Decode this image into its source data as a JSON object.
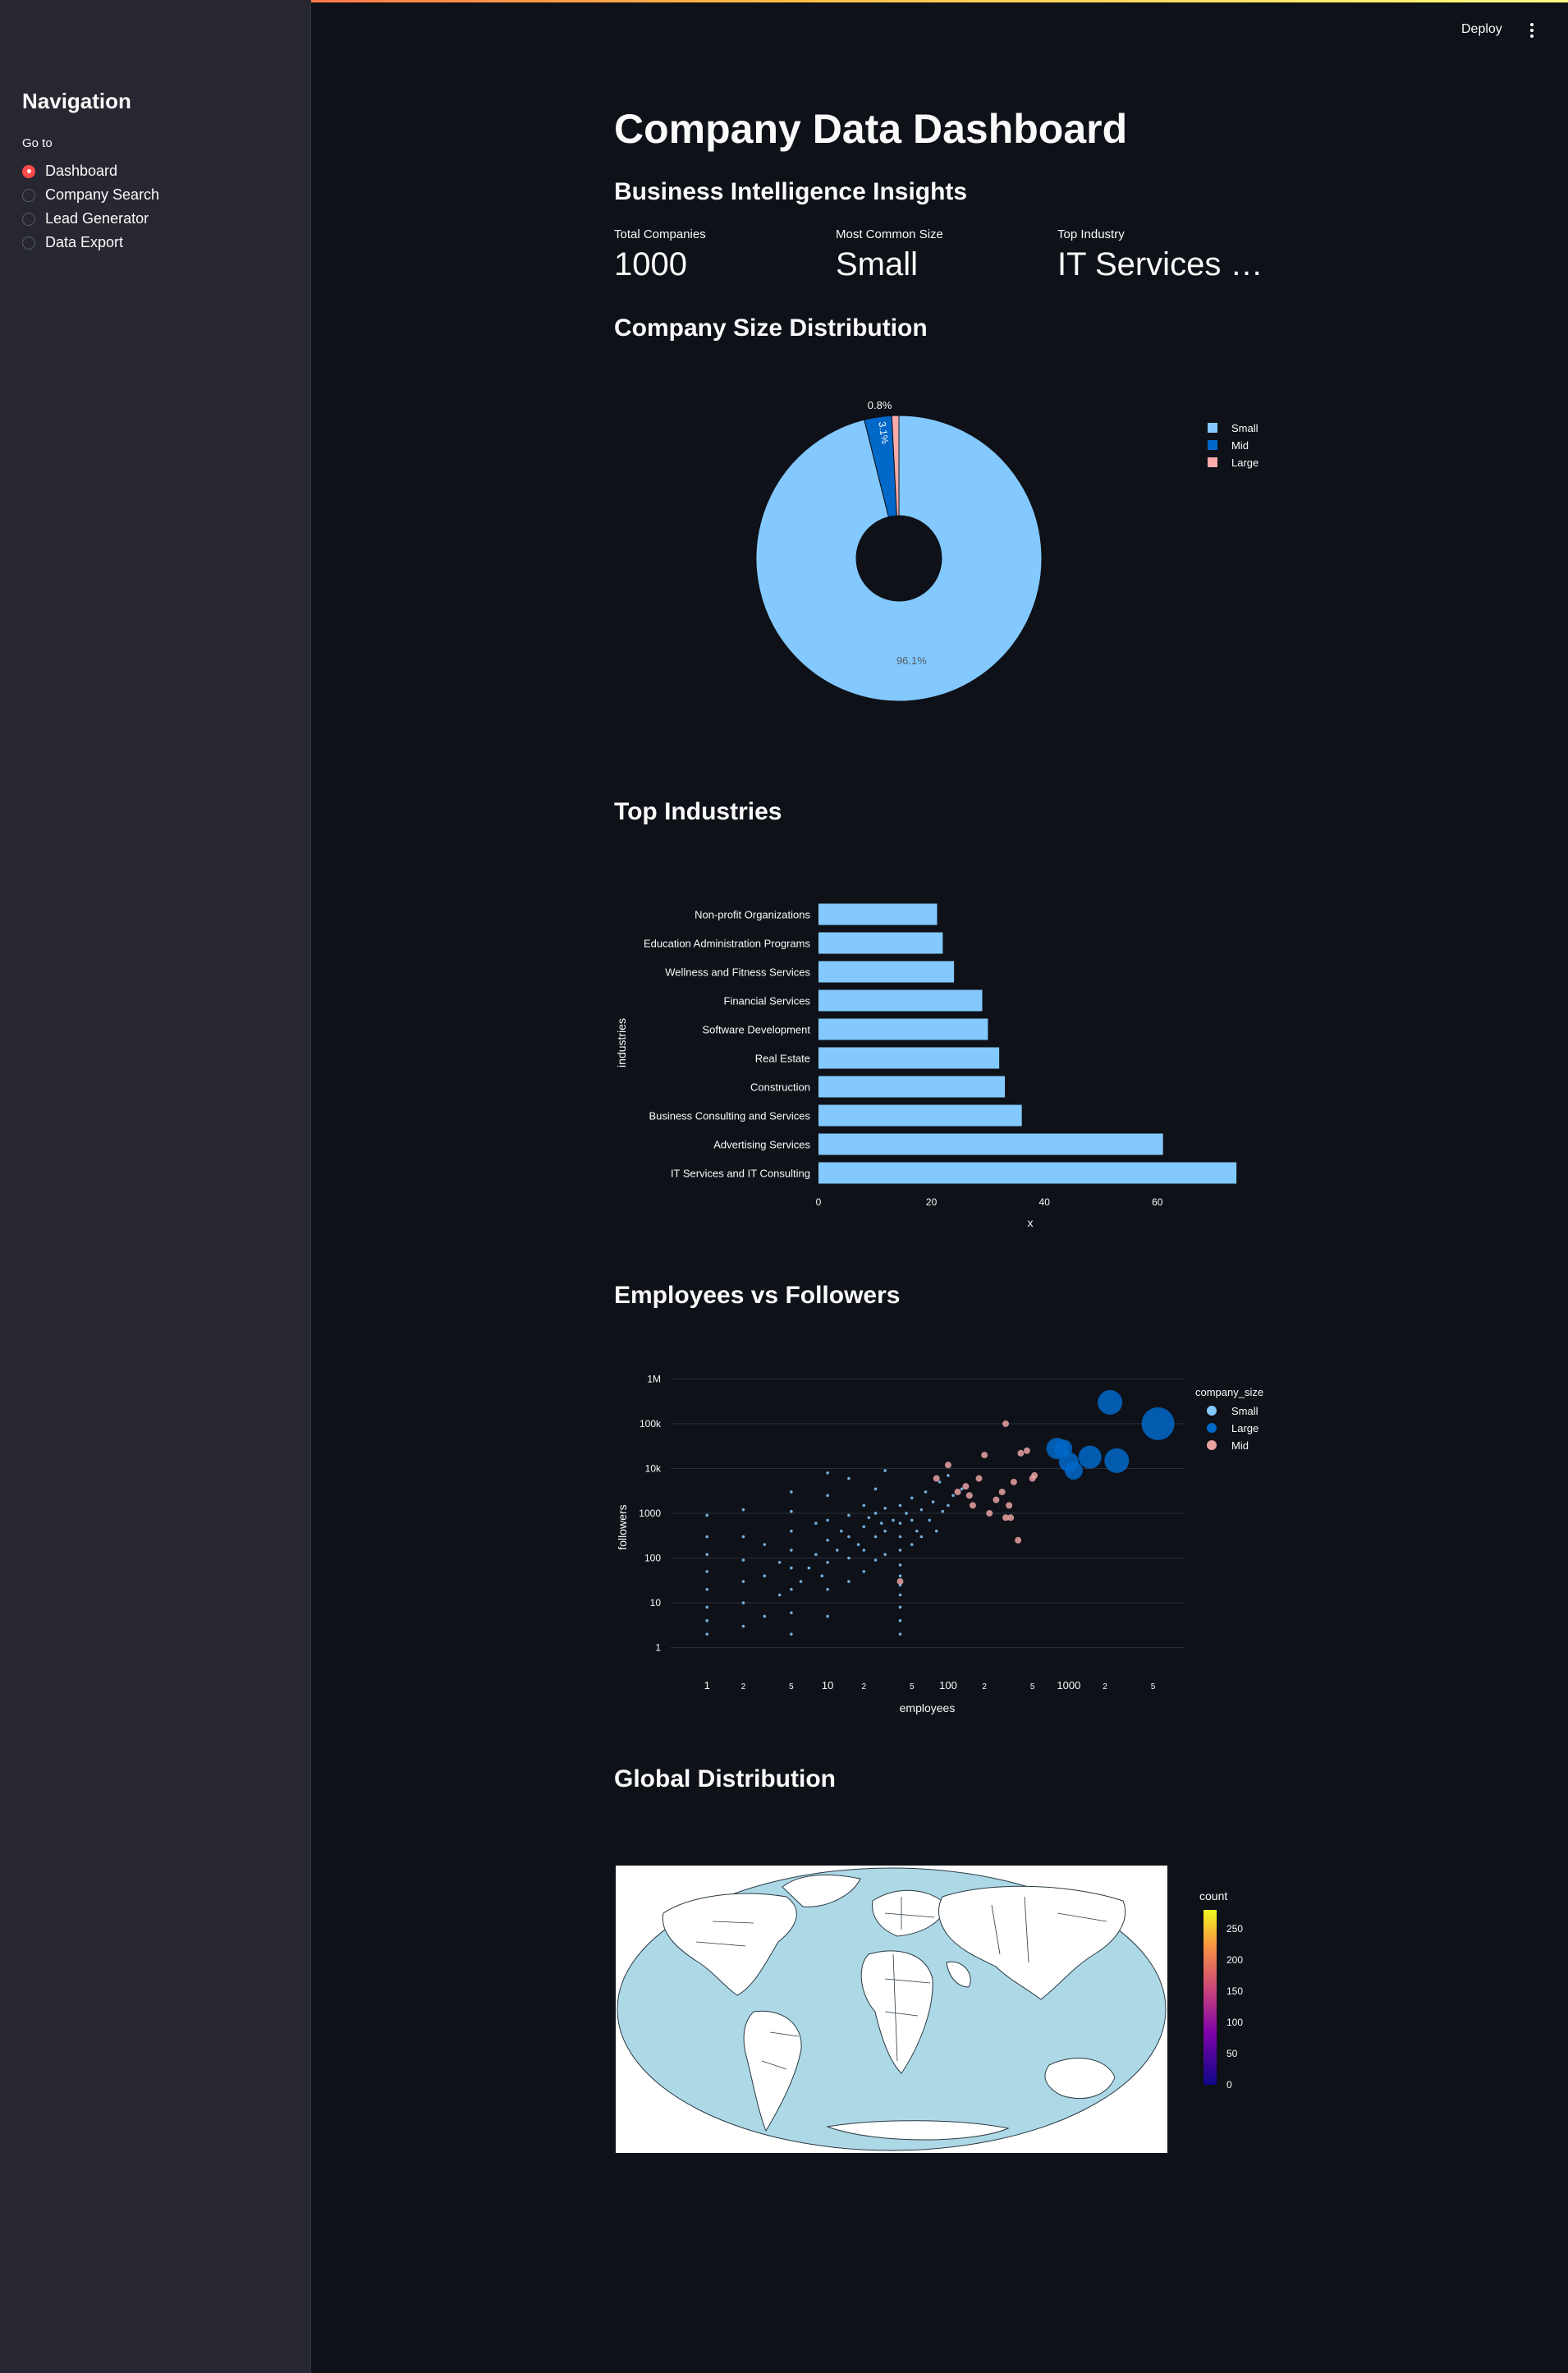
{
  "sidebar": {
    "title": "Navigation",
    "radio_label": "Go to",
    "items": [
      {
        "label": "Dashboard",
        "selected": true
      },
      {
        "label": "Company Search",
        "selected": false
      },
      {
        "label": "Lead Generator",
        "selected": false
      },
      {
        "label": "Data Export",
        "selected": false
      }
    ]
  },
  "header": {
    "deploy_label": "Deploy",
    "menu_icon": "kebab-menu-icon"
  },
  "main": {
    "title": "Company Data Dashboard",
    "insights_heading": "Business Intelligence Insights",
    "metrics": [
      {
        "label": "Total Companies",
        "value": "1000"
      },
      {
        "label": "Most Common Size",
        "value": "Small"
      },
      {
        "label": "Top Industry",
        "value": "IT Services and IT Consulting"
      }
    ],
    "size_heading": "Company Size Distribution",
    "industries_heading": "Top Industries",
    "scatter_heading": "Employees vs Followers",
    "map_heading": "Global Distribution"
  },
  "colors": {
    "accent": "#ff4b4b",
    "small": "#83c9ff",
    "mid": "#0068c9",
    "large": "#ffabab",
    "background": "#0e1117",
    "sidebar": "#262730",
    "ocean": "#add8e6"
  },
  "chart_data": [
    {
      "type": "pie",
      "hole": true,
      "labels": [
        "Small",
        "Mid",
        "Large"
      ],
      "values": [
        96.1,
        3.1,
        0.8
      ],
      "slice_labels": [
        "96.1%",
        "3.1%",
        "0.8%"
      ],
      "colors": [
        "#83c9ff",
        "#0068c9",
        "#ffabab"
      ],
      "legend": [
        "Small",
        "Mid",
        "Large"
      ],
      "legend_position": "top-right"
    },
    {
      "type": "bar",
      "orientation": "horizontal",
      "categories": [
        "IT Services and IT Consulting",
        "Advertising Services",
        "Business Consulting and Services",
        "Construction",
        "Real Estate",
        "Software Development",
        "Financial Services",
        "Wellness and Fitness Services",
        "Education Administration Programs",
        "Non-profit Organizations"
      ],
      "values": [
        74,
        61,
        36,
        33,
        32,
        30,
        29,
        24,
        22,
        21
      ],
      "xlabel": "x",
      "ylabel": "industries",
      "xticks": [
        "0",
        "20",
        "40",
        "60"
      ],
      "xlim": [
        0,
        75
      ],
      "color": "#83c9ff"
    },
    {
      "type": "scatter",
      "xlabel": "employees",
      "ylabel": "followers",
      "log_x": true,
      "log_y": true,
      "xlim": [
        0.5,
        9000
      ],
      "ylim": [
        0.7,
        2000000
      ],
      "yticks": [
        {
          "v": 1,
          "t": "1"
        },
        {
          "v": 10,
          "t": "10"
        },
        {
          "v": 100,
          "t": "100"
        },
        {
          "v": 1000,
          "t": "1000"
        },
        {
          "v": 10000,
          "t": "10k"
        },
        {
          "v": 100000,
          "t": "100k"
        },
        {
          "v": 1000000,
          "t": "1M"
        }
      ],
      "xticks": [
        {
          "v": 1,
          "t": "1",
          "major": true
        },
        {
          "v": 2,
          "t": "2"
        },
        {
          "v": 5,
          "t": "5"
        },
        {
          "v": 10,
          "t": "10",
          "major": true
        },
        {
          "v": 20,
          "t": "2"
        },
        {
          "v": 50,
          "t": "5"
        },
        {
          "v": 100,
          "t": "100",
          "major": true
        },
        {
          "v": 200,
          "t": "2"
        },
        {
          "v": 500,
          "t": "5"
        },
        {
          "v": 1000,
          "t": "1000",
          "major": true
        },
        {
          "v": 2000,
          "t": "2"
        },
        {
          "v": 5000,
          "t": "5"
        }
      ],
      "legend_title": "company_size",
      "series": [
        {
          "name": "Small",
          "color": "#83c9ff",
          "points": [
            [
              1,
              2
            ],
            [
              1,
              4
            ],
            [
              1,
              8
            ],
            [
              1,
              20
            ],
            [
              1,
              50
            ],
            [
              1,
              120
            ],
            [
              1,
              300
            ],
            [
              1,
              900
            ],
            [
              2,
              3
            ],
            [
              2,
              10
            ],
            [
              2,
              30
            ],
            [
              2,
              90
            ],
            [
              2,
              300
            ],
            [
              2,
              1200
            ],
            [
              3,
              5
            ],
            [
              3,
              40
            ],
            [
              3,
              200
            ],
            [
              4,
              15
            ],
            [
              4,
              80
            ],
            [
              5,
              2
            ],
            [
              5,
              6
            ],
            [
              5,
              20
            ],
            [
              5,
              60
            ],
            [
              5,
              150
            ],
            [
              5,
              400
            ],
            [
              5,
              1100
            ],
            [
              5,
              3000
            ],
            [
              6,
              30
            ],
            [
              7,
              60
            ],
            [
              8,
              120
            ],
            [
              8,
              600
            ],
            [
              9,
              40
            ],
            [
              10,
              5
            ],
            [
              10,
              20
            ],
            [
              10,
              80
            ],
            [
              10,
              250
            ],
            [
              10,
              700
            ],
            [
              10,
              2500
            ],
            [
              10,
              8000
            ],
            [
              12,
              150
            ],
            [
              13,
              400
            ],
            [
              15,
              30
            ],
            [
              15,
              100
            ],
            [
              15,
              300
            ],
            [
              15,
              900
            ],
            [
              15,
              6000
            ],
            [
              18,
              200
            ],
            [
              20,
              50
            ],
            [
              20,
              150
            ],
            [
              20,
              500
            ],
            [
              20,
              1500
            ],
            [
              22,
              800
            ],
            [
              25,
              90
            ],
            [
              25,
              300
            ],
            [
              25,
              1000
            ],
            [
              25,
              3500
            ],
            [
              28,
              600
            ],
            [
              30,
              120
            ],
            [
              30,
              400
            ],
            [
              30,
              1300
            ],
            [
              30,
              9000
            ],
            [
              35,
              700
            ],
            [
              40,
              2
            ],
            [
              40,
              4
            ],
            [
              40,
              8
            ],
            [
              40,
              15
            ],
            [
              40,
              25
            ],
            [
              40,
              40
            ],
            [
              40,
              70
            ],
            [
              40,
              150
            ],
            [
              40,
              300
            ],
            [
              40,
              600
            ],
            [
              40,
              1500
            ],
            [
              45,
              1000
            ],
            [
              50,
              200
            ],
            [
              50,
              700
            ],
            [
              50,
              2200
            ],
            [
              55,
              400
            ],
            [
              60,
              300
            ],
            [
              60,
              1200
            ],
            [
              65,
              3000
            ],
            [
              70,
              700
            ],
            [
              75,
              1800
            ],
            [
              80,
              400
            ],
            [
              85,
              5000
            ],
            [
              90,
              1100
            ],
            [
              100,
              1500
            ],
            [
              100,
              7000
            ],
            [
              110,
              2500
            ],
            [
              130,
              3500
            ]
          ]
        },
        {
          "name": "Large",
          "color": "#0068c9",
          "points": [
            [
              800,
              28000,
              13
            ],
            [
              900,
              28000,
              11
            ],
            [
              1000,
              14000,
              12
            ],
            [
              1100,
              9000,
              11
            ],
            [
              1500,
              18000,
              14
            ],
            [
              2200,
              300000,
              15
            ],
            [
              2500,
              15000,
              15
            ],
            [
              5500,
              100000,
              20
            ]
          ]
        },
        {
          "name": "Mid",
          "color": "#e8a2a2",
          "points": [
            [
              40,
              30
            ],
            [
              80,
              6000
            ],
            [
              100,
              12000
            ],
            [
              120,
              3000
            ],
            [
              140,
              4000
            ],
            [
              150,
              2500
            ],
            [
              160,
              1500
            ],
            [
              180,
              6000
            ],
            [
              200,
              20000
            ],
            [
              220,
              1000
            ],
            [
              250,
              2000
            ],
            [
              280,
              3000
            ],
            [
              300,
              800
            ],
            [
              300,
              100000
            ],
            [
              320,
              1500
            ],
            [
              330,
              800
            ],
            [
              350,
              5000
            ],
            [
              380,
              250
            ],
            [
              400,
              22000
            ],
            [
              450,
              25000
            ],
            [
              500,
              6000
            ],
            [
              520,
              7000
            ]
          ]
        }
      ]
    },
    {
      "type": "map",
      "projection": "robinson",
      "colorbar_title": "count",
      "colorbar_ticks": [
        "250",
        "200",
        "150",
        "100",
        "50",
        "0"
      ],
      "range": [
        0,
        280
      ]
    }
  ]
}
